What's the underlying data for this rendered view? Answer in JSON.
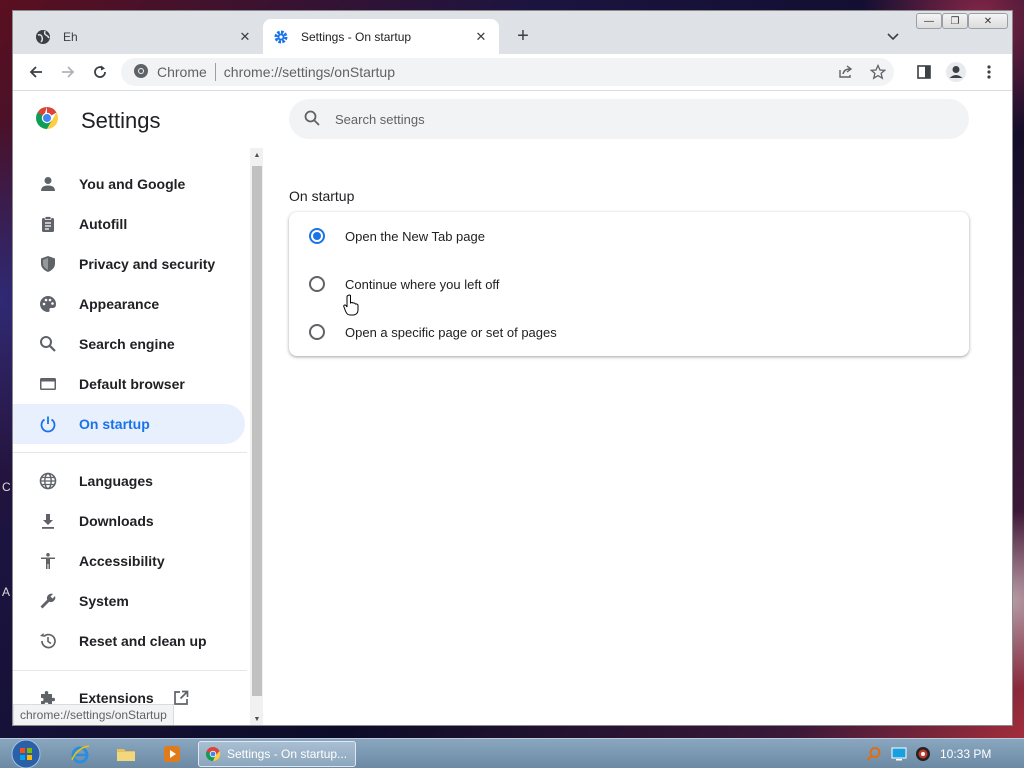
{
  "browser": {
    "tabs": [
      {
        "title": "Eh",
        "active": false
      },
      {
        "title": "Settings - On startup",
        "active": true
      }
    ],
    "chip_label": "Chrome",
    "url": "chrome://settings/onStartup"
  },
  "settings": {
    "title": "Settings",
    "search_placeholder": "Search settings",
    "nav": [
      {
        "label": "You and Google",
        "icon": "person-icon"
      },
      {
        "label": "Autofill",
        "icon": "clipboard-icon"
      },
      {
        "label": "Privacy and security",
        "icon": "shield-icon"
      },
      {
        "label": "Appearance",
        "icon": "palette-icon"
      },
      {
        "label": "Search engine",
        "icon": "search-icon"
      },
      {
        "label": "Default browser",
        "icon": "browser-icon"
      },
      {
        "label": "On startup",
        "icon": "power-icon",
        "selected": true
      },
      {
        "label": "Languages",
        "icon": "globe-icon"
      },
      {
        "label": "Downloads",
        "icon": "download-icon"
      },
      {
        "label": "Accessibility",
        "icon": "accessibility-icon"
      },
      {
        "label": "System",
        "icon": "wrench-icon"
      },
      {
        "label": "Reset and clean up",
        "icon": "history-icon"
      },
      {
        "label": "Extensions",
        "icon": "puzzle-icon"
      }
    ],
    "section_title": "On startup",
    "options": [
      {
        "label": "Open the New Tab page",
        "checked": true
      },
      {
        "label": "Continue where you left off",
        "checked": false
      },
      {
        "label": "Open a specific page or set of pages",
        "checked": false
      }
    ],
    "status_url": "chrome://settings/onStartup"
  },
  "taskbar": {
    "task_title": "Settings - On startup...",
    "clock": "10:33 PM"
  },
  "colors": {
    "accent": "#1a73e8",
    "selected_bg": "#e8f0fe"
  }
}
